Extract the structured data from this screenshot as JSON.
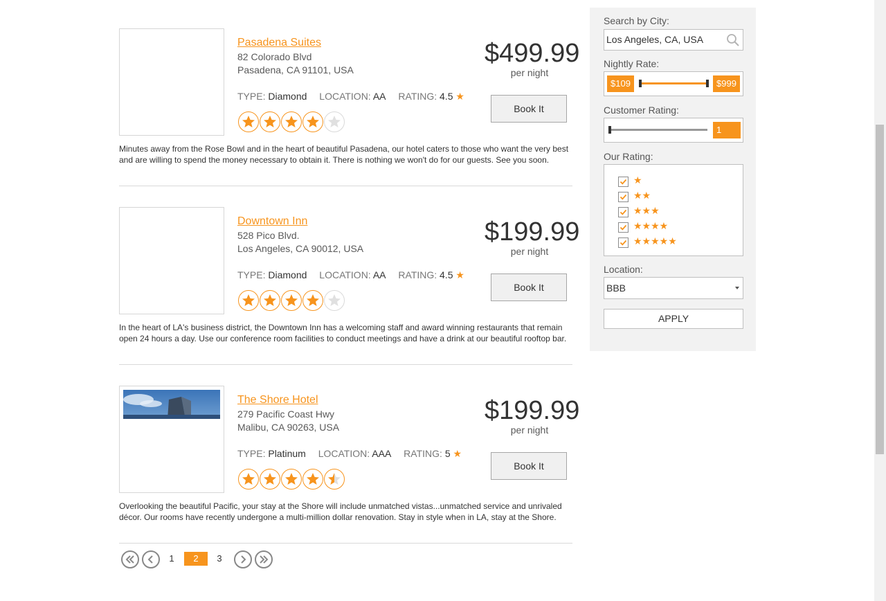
{
  "accent_color": "#f7941d",
  "hotels": [
    {
      "name": "Pasadena Suites",
      "address_line1": "82 Colorado Blvd",
      "address_line2": "Pasadena, CA 91101, USA",
      "type_label": "TYPE:",
      "type": "Diamond",
      "location_label": "LOCATION:",
      "location": "AA",
      "rating_label": "RATING:",
      "rating": "4.5",
      "star_fill": [
        1,
        1,
        1,
        1,
        0
      ],
      "price": "$499.99",
      "per_night": "per night",
      "book_label": "Book It",
      "description": "Minutes away from the Rose Bowl and in the heart of beautiful Pasadena, our hotel caters to those who want the very best and are willing to spend the money necessary to obtain it. There is nothing we won't do for our guests. See you soon.",
      "has_photo": false
    },
    {
      "name": "Downtown Inn",
      "address_line1": "528 Pico Blvd.",
      "address_line2": "Los Angeles, CA 90012, USA",
      "type_label": "TYPE:",
      "type": "Diamond",
      "location_label": "LOCATION:",
      "location": "AA",
      "rating_label": "RATING:",
      "rating": "4.5",
      "star_fill": [
        1,
        1,
        1,
        1,
        0
      ],
      "price": "$199.99",
      "per_night": "per night",
      "book_label": "Book It",
      "description": "In the heart of LA's business district, the Downtown Inn has a welcoming staff and award winning restaurants that remain open 24 hours a day. Use our conference room facilities to conduct meetings and have a drink at our beautiful rooftop bar.",
      "has_photo": false
    },
    {
      "name": "The Shore Hotel",
      "address_line1": "279 Pacific Coast Hwy",
      "address_line2": "Malibu, CA 90263, USA",
      "type_label": "TYPE:",
      "type": "Platinum",
      "location_label": "LOCATION:",
      "location": "AAA",
      "rating_label": "RATING:",
      "rating": "5",
      "star_fill": [
        1,
        1,
        1,
        1,
        0.5
      ],
      "price": "$199.99",
      "per_night": "per night",
      "book_label": "Book It",
      "description": "Overlooking the beautiful Pacific, your stay at the Shore will include unmatched vistas...unmatched service and unrivaled décor. Our rooms have recently undergone a multi-million dollar renovation. Stay in style when in LA, stay at the Shore.",
      "has_photo": true
    }
  ],
  "pager": {
    "pages": [
      "1",
      "2",
      "3"
    ],
    "current": "2"
  },
  "filters": {
    "city_label": "Search by City:",
    "city_value": "Los Angeles, CA, USA",
    "rate_label": "Nightly Rate:",
    "rate_min": "$109",
    "rate_max": "$999",
    "customer_rating_label": "Customer Rating:",
    "customer_rating_value": "1",
    "our_rating_label": "Our Rating:",
    "our_rating_rows": [
      "★",
      "★★",
      "★★★",
      "★★★★",
      "★★★★★"
    ],
    "location_label": "Location:",
    "location_value": "BBB",
    "apply_label": "APPLY"
  }
}
